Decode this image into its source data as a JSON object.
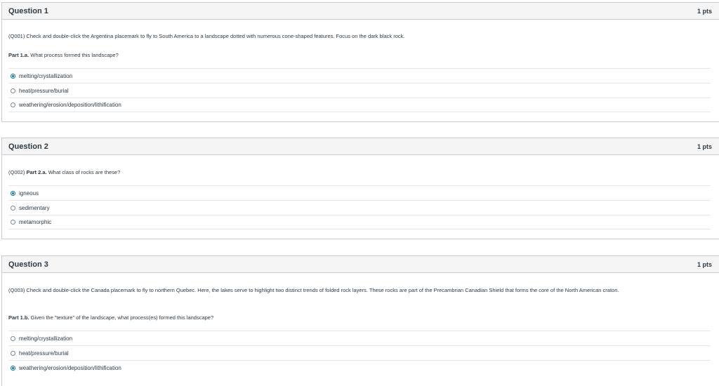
{
  "questions": [
    {
      "title": "Question 1",
      "points": "1 pts",
      "text_id": "(Q001) Check and double-click the Argentina placemark to fly to South America to a landscape dotted with numerous cone-shaped features. Focus on the dark black rock.",
      "part_label": "Part 1.a.",
      "part_text": " What process formed this landscape?",
      "answers": [
        {
          "label": "melting/crystallization",
          "checked": true
        },
        {
          "label": "heat/pressure/burial",
          "checked": false
        },
        {
          "label": "weathering/erosion/deposition/lithification",
          "checked": false
        }
      ]
    },
    {
      "title": "Question 2",
      "points": "1 pts",
      "text_id": "(Q002)",
      "part_label": "Part 2.a.",
      "part_text": " What class of rocks are these?",
      "answers": [
        {
          "label": "igneous",
          "checked": true
        },
        {
          "label": "sedimentary",
          "checked": false
        },
        {
          "label": "metamorphic",
          "checked": false
        }
      ]
    },
    {
      "title": "Question 3",
      "points": "1 pts",
      "text_id": "(Q003) Check and double-click the Canada placemark to fly to northern Quebec. Here, the lakes serve to highlight two distinct trends of folded rock layers. These rocks are part of the Precambrian Canadian Shield that forms the core of the North American craton.",
      "part_label": "Part 1.b.",
      "part_text": " Given the \"texture\" of the landscape, what process(es) formed this landscape?",
      "answers": [
        {
          "label": "melting/crystallization",
          "checked": false
        },
        {
          "label": "heat/pressure/burial",
          "checked": false
        },
        {
          "label": "weathering/erosion/deposition/lithification",
          "checked": true
        }
      ]
    }
  ]
}
